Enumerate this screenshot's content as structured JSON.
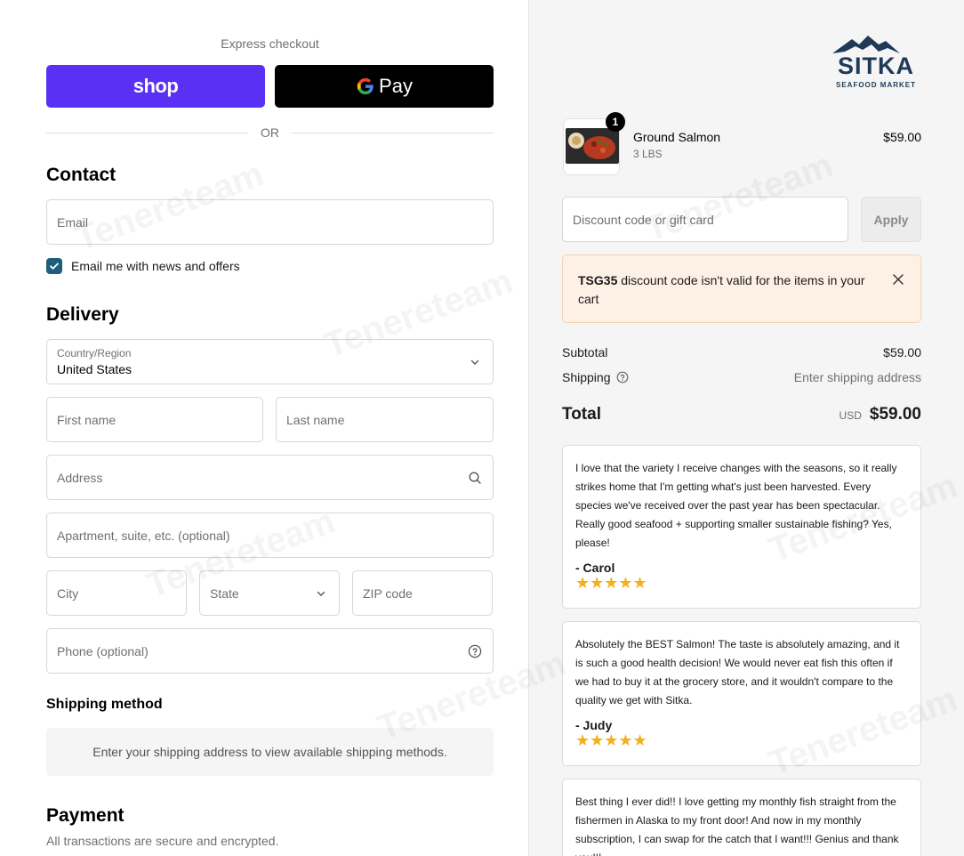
{
  "express": {
    "label": "Express checkout",
    "shop_label": "shop",
    "gpay_label": "Pay",
    "or_label": "OR"
  },
  "contact": {
    "heading": "Contact",
    "email_placeholder": "Email",
    "newsletter_label": "Email me with news and offers",
    "newsletter_checked": true
  },
  "delivery": {
    "heading": "Delivery",
    "country_label": "Country/Region",
    "country_value": "United States",
    "first_name_placeholder": "First name",
    "last_name_placeholder": "Last name",
    "address_placeholder": "Address",
    "apartment_placeholder": "Apartment, suite, etc. (optional)",
    "city_placeholder": "City",
    "state_placeholder": "State",
    "zip_placeholder": "ZIP code",
    "phone_placeholder": "Phone (optional)"
  },
  "shipping_method": {
    "heading": "Shipping method",
    "message": "Enter your shipping address to view available shipping methods."
  },
  "payment": {
    "heading": "Payment",
    "subtitle": "All transactions are secure and encrypted."
  },
  "brand": {
    "name": "SITKA",
    "tagline": "SEAFOOD MARKET",
    "color": "#1e3a57"
  },
  "cart": {
    "item": {
      "name": "Ground Salmon",
      "variant": "3 LBS",
      "price": "$59.00",
      "quantity": "1"
    },
    "discount_placeholder": "Discount code or gift card",
    "apply_label": "Apply",
    "alert": {
      "code": "TSG35",
      "message": " discount code isn't valid for the items in your cart"
    },
    "subtotal_label": "Subtotal",
    "subtotal_value": "$59.00",
    "shipping_label": "Shipping",
    "shipping_value": "Enter shipping address",
    "total_label": "Total",
    "total_currency": "USD",
    "total_value": "$59.00"
  },
  "reviews": [
    {
      "text": "I love that the variety I receive changes with the seasons, so it really strikes home that I'm getting what's just been harvested. Every species we've received over the past year has been spectacular. Really good seafood + supporting smaller sustainable fishing? Yes, please!",
      "author": "- Carol",
      "stars": "★★★★★"
    },
    {
      "text": "Absolutely the BEST Salmon! The taste is absolutely amazing, and it is such a good health decision! We would never eat fish this often if we had to buy it at the grocery store, and it wouldn't compare to the quality we get with Sitka.",
      "author": "- Judy",
      "stars": "★★★★★"
    },
    {
      "text": "Best thing I ever did!! I love getting my monthly fish straight from the fishermen in Alaska to my front door! And now in my monthly subscription, I can swap for the catch that I want!!! Genius and thank you!!!",
      "author": "",
      "stars": ""
    }
  ],
  "watermark": "Tenereteam",
  "colors": {
    "shop_purple": "#5a31f4",
    "checkbox_blue": "#1f5e7a",
    "star_gold": "#f2b01e",
    "alert_bg": "#fdf1e6"
  }
}
